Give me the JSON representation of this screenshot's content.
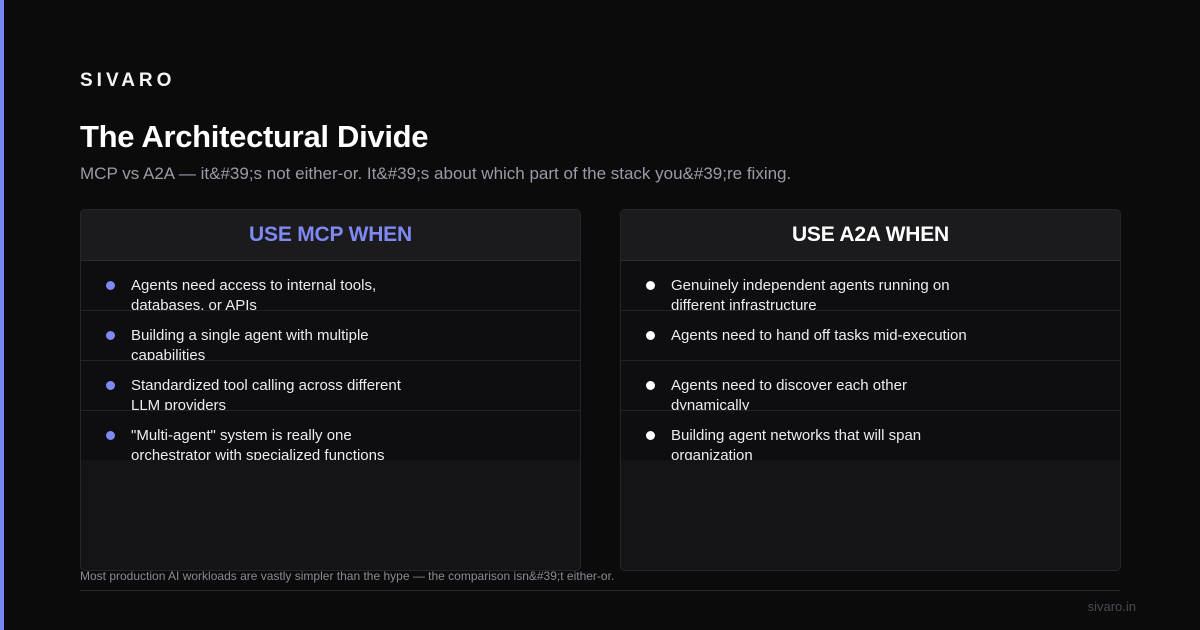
{
  "brand": "SIVARO",
  "title": "The Architectural Divide",
  "subtitle": "MCP vs A2A — it&#39;s not either-or. It&#39;s about which part of the stack you&#39;re fixing.",
  "colors": {
    "accent": "#7c86f0",
    "mcp_heading": "#8089f2",
    "background": "#0b0b0c"
  },
  "mcp": {
    "heading": "USE MCP WHEN",
    "items": [
      "Agents need access to internal tools, databases, or APIs",
      "Building a single agent with multiple capabilities",
      "Standardized tool calling across different LLM providers",
      "\"Multi-agent\" system is really one orchestrator with specialized functions"
    ]
  },
  "a2a": {
    "heading": "USE A2A WHEN",
    "items": [
      "Genuinely independent agents running on different infrastructure",
      "Agents need to hand off tasks mid-execution",
      "Agents need to discover each other dynamically",
      "Building agent networks that will span organization"
    ]
  },
  "footer": {
    "note": "Most production AI workloads are vastly simpler than the hype — the comparison isn&#39;t either-or.",
    "site": "sivaro.in"
  }
}
